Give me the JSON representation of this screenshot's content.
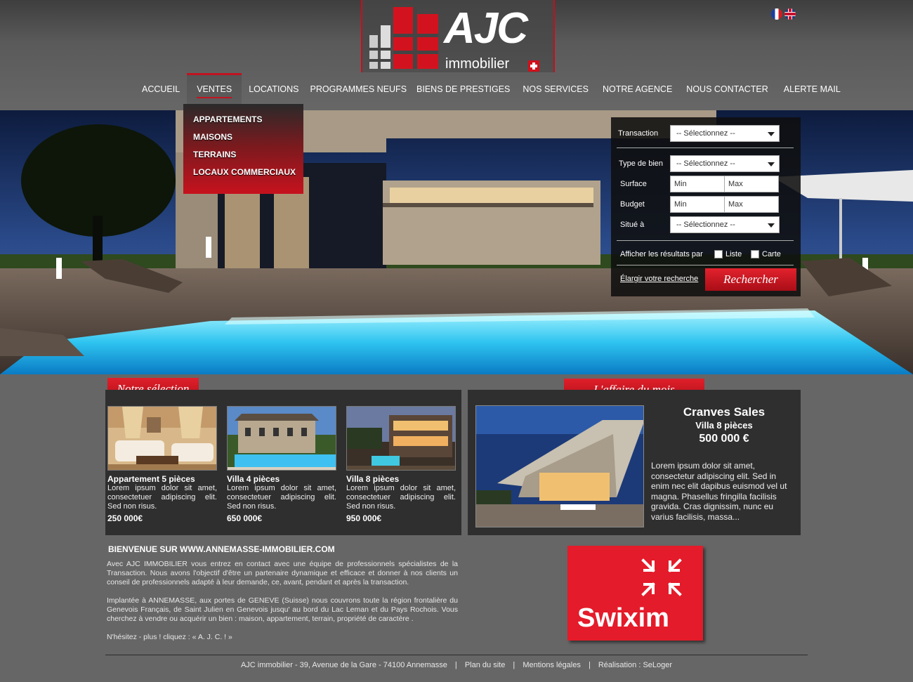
{
  "header": {
    "logo_title": "AJC",
    "logo_subtitle": "immobilier",
    "languages": [
      "fr-flag-icon",
      "en-flag-icon"
    ]
  },
  "nav": {
    "items": [
      {
        "label": "ACCUEIL"
      },
      {
        "label": "VENTES"
      },
      {
        "label": "LOCATIONS"
      },
      {
        "label": "PROGRAMMES NEUFS"
      },
      {
        "label": "BIENS DE PRESTIGES"
      },
      {
        "label": "NOS SERVICES"
      },
      {
        "label": "NOTRE AGENCE"
      },
      {
        "label": "NOUS CONTACTER"
      },
      {
        "label": "ALERTE MAIL"
      }
    ],
    "submenu": [
      "APPARTEMENTS",
      "MAISONS",
      "TERRAINS",
      "LOCAUX COMMERCIAUX"
    ]
  },
  "search": {
    "transaction_label": "Transaction",
    "transaction_value": "-- Sélectionnez --",
    "type_label": "Type de bien",
    "type_value": "-- Sélectionnez --",
    "surface_label": "Surface",
    "surface_min": "Min",
    "surface_max": "Max",
    "budget_label": "Budget",
    "budget_min": "Min",
    "budget_max": "Max",
    "location_label": "Situé à",
    "location_value": "-- Sélectionnez --",
    "display_label": "Afficher les résultats par",
    "opt_list": "Liste",
    "opt_map": "Carte",
    "enlarge_link": "Élargir votre recherche",
    "submit": "Rechercher"
  },
  "selection": {
    "title": "Notre sélection",
    "items": [
      {
        "title": "Appartement 5 pièces",
        "desc": "Lorem ipsum dolor sit amet, consectetuer adipiscing elit. Sed non risus.",
        "price": "250 000€"
      },
      {
        "title": "Villa 4 pièces",
        "desc": "Lorem ipsum dolor sit amet, consectetuer adipiscing elit. Sed non risus.",
        "price": "650 000€"
      },
      {
        "title": "Villa 8 pièces",
        "desc": "Lorem ipsum dolor sit amet, consectetuer adipiscing elit. Sed non risus.",
        "price": "950 000€"
      }
    ]
  },
  "deal": {
    "title": "L'affaire du mois",
    "city": "Cranves Sales",
    "type": "Villa 8 pièces",
    "price": "500 000 €",
    "desc": "Lorem ipsum dolor sit amet, consectetur adipiscing elit. Sed in enim nec elit dapibus euismod vel ut magna. Phasellus fringilla facilisis gravida. Cras dignissim, nunc eu varius facilisis, massa..."
  },
  "welcome": {
    "title": "BIENVENUE SUR WWW.ANNEMASSE-IMMOBILIER.COM",
    "p1": "Avec AJC IMMOBILIER vous entrez en contact avec une équipe de professionnels spécialistes de la Transaction. Nous avons l'objectif d'être un partenaire dynamique et efficace et donner à nos clients un conseil de professionnels adapté à leur demande, ce, avant, pendant et après la transaction.",
    "p2": "Implantée à ANNEMASSE, aux portes de GENEVE (Suisse) nous couvrons toute la région frontalière du Genevois Français, de Saint Julien en Genevois jusqu' au bord du Lac Leman et du Pays Rochois. Vous cherchez à vendre ou acquérir un bien : maison, appartement, terrain, propriété de caractère .",
    "p3": "N'hésitez - plus ! cliquez : « A. J. C. ! »"
  },
  "partner": {
    "name": "Swixim"
  },
  "footer": {
    "address": "AJC immobilier - 39, Avenue de la Gare - 74100 Annemasse",
    "sitemap": "Plan du site",
    "legal": "Mentions légales",
    "credit": "Réalisation : SeLoger",
    "separator": "|"
  },
  "colors": {
    "accent": "#c6121e",
    "background": "#666666",
    "panel": "#2f2f2f"
  }
}
